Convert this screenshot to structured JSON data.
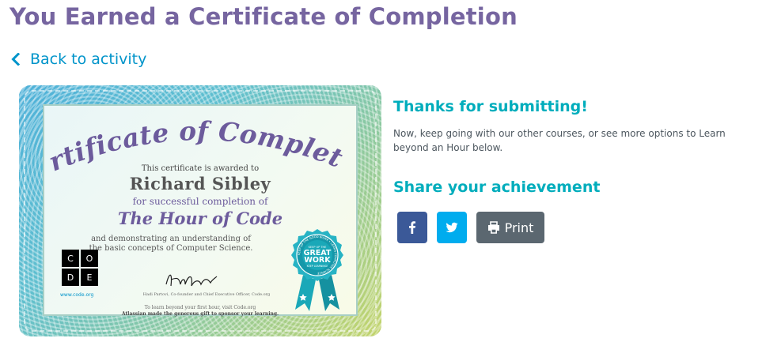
{
  "page": {
    "title": "You Earned a Certificate of Completion",
    "back_link": "Back to activity"
  },
  "certificate": {
    "heading": "Certificate of Completion",
    "awarded_text": "This certificate is awarded to",
    "recipient": "Richard Sibley",
    "success_text": "for successful completion of",
    "course": "The Hour of Code",
    "demonstrating_line1": "and demonstrating an understanding of",
    "demonstrating_line2": "the basic concepts of Computer Science.",
    "logo_letters": [
      "C",
      "O",
      "D",
      "E"
    ],
    "logo_url": "www.code.org",
    "signer": "Hadi Partovi, Co-founder and Chief Executive Officer, Code.org",
    "learn_beyond": "To learn beyond your first hour, visit Code.org",
    "sponsor": "Atlassian made the generous gift to sponsor your learning.",
    "badge": {
      "ring_text": "KEEP UP THE GOOD WORK • LEARN COMPUTER SCIENCE",
      "top_text": "KEEP UP THE",
      "main_line1": "GREAT",
      "main_line2": "WORK",
      "bottom_text": "KEEP LEARNING!"
    }
  },
  "panel": {
    "thanks_title": "Thanks for submitting!",
    "thanks_body": "Now, keep going with our other courses, or see more options to Learn beyond an Hour below.",
    "share_title": "Share your achievement",
    "print_label": "Print"
  },
  "colors": {
    "title_purple": "#7665a0",
    "link_blue": "#0094ca",
    "heading_teal": "#00adbc",
    "facebook": "#3b5998",
    "twitter": "#00acee",
    "print_gray": "#5b6770"
  },
  "icons": {
    "back": "chevron-left-icon",
    "facebook": "facebook-icon",
    "twitter": "twitter-icon",
    "print": "print-icon"
  }
}
